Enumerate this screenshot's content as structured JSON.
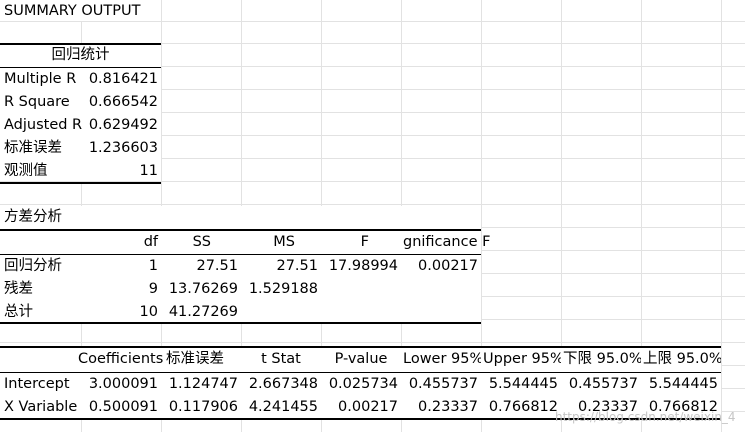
{
  "title": "SUMMARY OUTPUT",
  "regression_stats": {
    "header": "回归统计",
    "rows": [
      {
        "label": "Multiple R",
        "value": "0.816421"
      },
      {
        "label": "R Square",
        "value": "0.666542"
      },
      {
        "label": "Adjusted R",
        "value": "0.629492"
      },
      {
        "label": "标准误差",
        "value": "1.236603"
      },
      {
        "label": "观测值",
        "value": "11"
      }
    ]
  },
  "anova": {
    "title": "方差分析",
    "headers": [
      "",
      "df",
      "SS",
      "MS",
      "F",
      "gnificance F"
    ],
    "rows": [
      [
        "回归分析",
        "1",
        "27.51",
        "27.51",
        "17.98994",
        "0.00217"
      ],
      [
        "残差",
        "9",
        "13.76269",
        "1.529188",
        "",
        ""
      ],
      [
        "总计",
        "10",
        "41.27269",
        "",
        "",
        ""
      ]
    ]
  },
  "coefficients": {
    "headers": [
      "",
      "Coefficients",
      "标准误差",
      "t Stat",
      "P-value",
      "Lower 95%",
      "Upper 95%",
      "下限 95.0%",
      "上限 95.0%"
    ],
    "rows": [
      [
        "Intercept",
        "3.000091",
        "1.124747",
        "2.667348",
        "0.025734",
        "0.455737",
        "5.544445",
        "0.455737",
        "5.544445"
      ],
      [
        "X Variable",
        "0.500091",
        "0.117906",
        "4.241455",
        "0.00217",
        "0.23337",
        "0.766812",
        "0.23337",
        "0.766812"
      ]
    ]
  },
  "watermark": "https://blog.csdn.net/weixin_4"
}
